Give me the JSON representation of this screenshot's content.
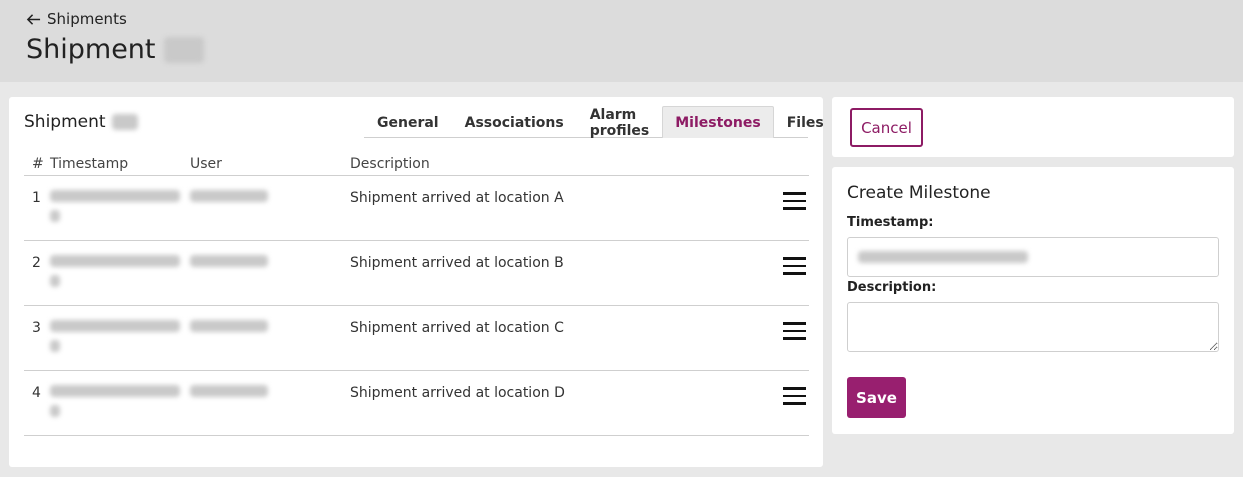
{
  "header": {
    "back_label": "Shipments",
    "page_title": "Shipment"
  },
  "main": {
    "title": "Shipment",
    "tabs": [
      {
        "label": "General"
      },
      {
        "label": "Associations"
      },
      {
        "label": "Alarm profiles"
      },
      {
        "label": "Milestones",
        "active": true
      },
      {
        "label": "Files"
      }
    ],
    "table": {
      "headers": [
        "#",
        "Timestamp",
        "User",
        "Description"
      ],
      "rows": [
        {
          "num": "1",
          "description": "Shipment arrived at location A"
        },
        {
          "num": "2",
          "description": "Shipment arrived at location B"
        },
        {
          "num": "3",
          "description": "Shipment arrived at location C"
        },
        {
          "num": "4",
          "description": "Shipment arrived at location D"
        }
      ]
    }
  },
  "cancel_label": "Cancel",
  "form": {
    "title": "Create Milestone",
    "timestamp_label": "Timestamp:",
    "description_label": "Description:",
    "save_label": "Save"
  },
  "colors": {
    "accent": "#8d1b64",
    "save_bg": "#981f6f"
  }
}
